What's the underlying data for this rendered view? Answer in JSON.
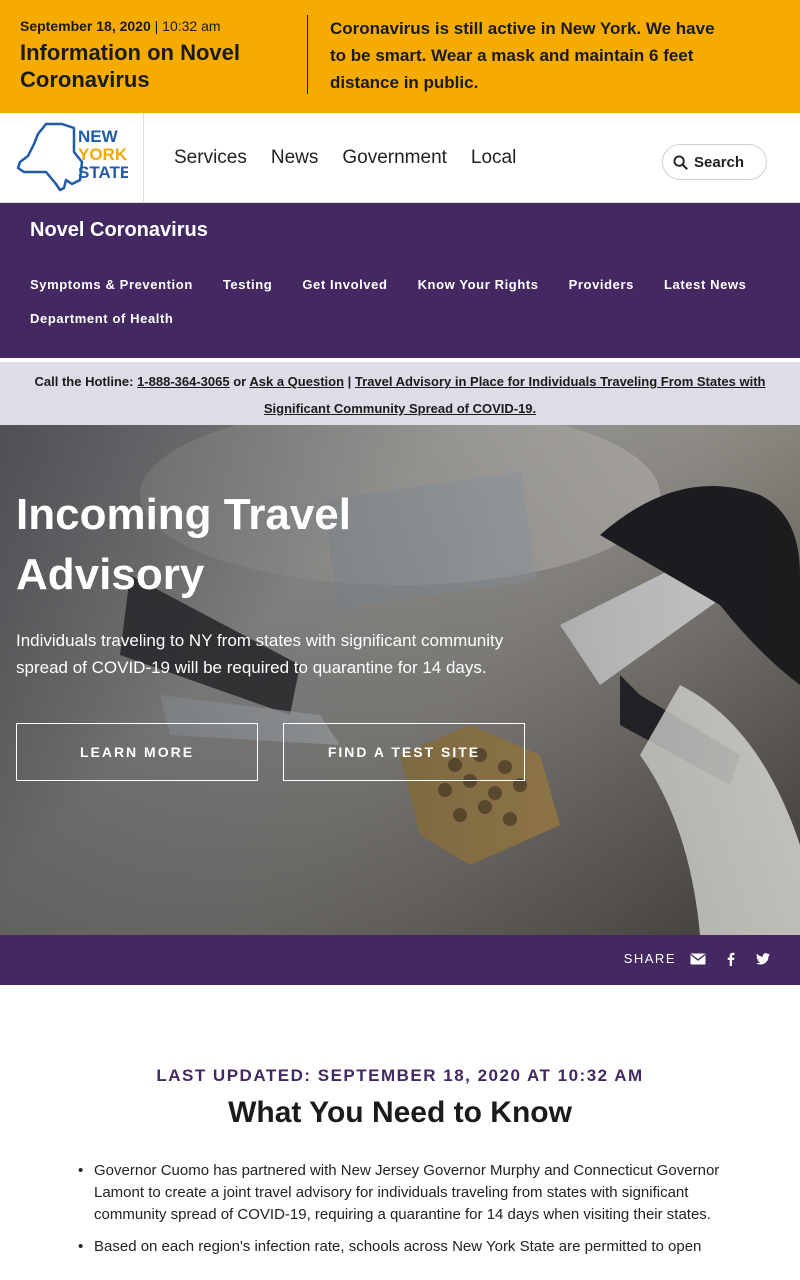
{
  "alert": {
    "date": "September 18, 2020",
    "time": "10:32 am",
    "title": "Information on Novel Coronavirus",
    "message": "Coronavirus is still active in New York. We have to be smart. Wear a mask and maintain 6 feet distance in public."
  },
  "header": {
    "logo_lines": [
      "NEW",
      "YORK",
      "STATE"
    ],
    "nav": [
      "Services",
      "News",
      "Government",
      "Local"
    ],
    "search_label": "Search"
  },
  "subnav": {
    "title": "Novel Coronavirus",
    "links": [
      "Symptoms & Prevention",
      "Testing",
      "Get Involved",
      "Know Your Rights",
      "Providers",
      "Latest News",
      "Department of Health"
    ]
  },
  "hotline": {
    "prefix": "Call the Hotline:",
    "phone": "1-888-364-3065",
    "or": "or",
    "ask": "Ask a Question",
    "sep": "|",
    "advisory": "Travel Advisory in Place for Individuals Traveling From States with Significant Community Spread of COVID-19."
  },
  "hero": {
    "title": "Incoming Travel Advisory",
    "text": "Individuals traveling to NY from states with significant community spread of COVID-19 will be required to quarantine for 14 days.",
    "btn_learn": "LEARN MORE",
    "btn_test": "FIND A TEST SITE"
  },
  "share": {
    "label": "SHARE",
    "icons": [
      "envelope-icon",
      "facebook-icon",
      "twitter-icon"
    ]
  },
  "content": {
    "updated": "LAST UPDATED: SEPTEMBER 18, 2020 AT 10:32 AM",
    "title": "What You Need to Know",
    "bullets": [
      "Governor Cuomo has partnered with New Jersey Governor Murphy and Connecticut Governor Lamont to create a joint travel advisory for individuals traveling from states with significant community spread of COVID-19, requiring a quarantine for 14 days when visiting their states.",
      "Based on each region's infection rate, schools across New York State are permitted to open"
    ]
  },
  "colors": {
    "alert_bg": "#f5ab00",
    "purple": "#432861",
    "hotline_bg": "#dcdde6",
    "logo_blue": "#1f5ba8",
    "logo_gold": "#f2a900"
  }
}
